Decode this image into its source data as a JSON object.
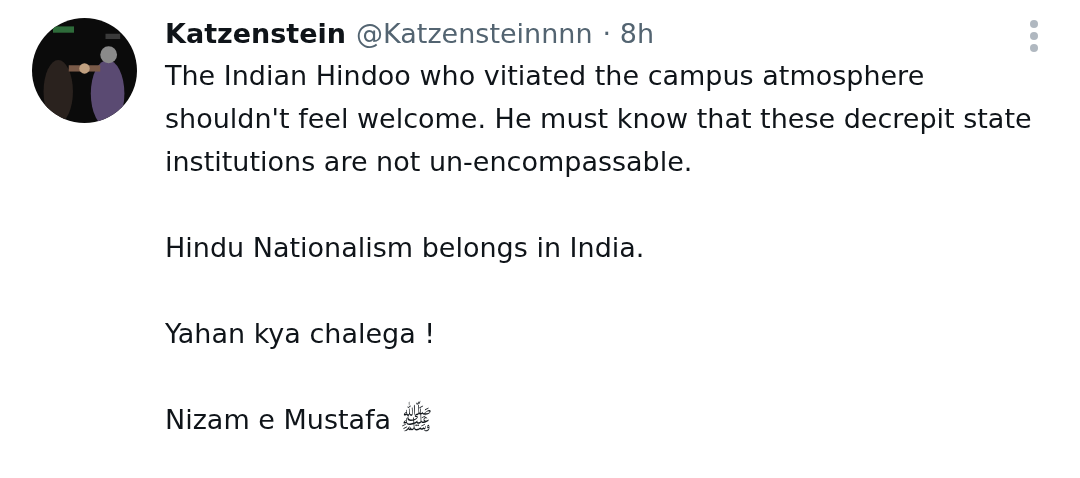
{
  "post": {
    "author": {
      "name": "Katzenstein",
      "handle": "@Katzensteinnnn",
      "time": "· 8h"
    },
    "paragraphs": [
      "The Indian Hindoo who vitiated the campus atmosphere shouldn't feel welcome. He must know that these decrepit state institutions are not un-encompassable.",
      "Hindu Nationalism belongs in India.",
      "Yahan kya chalega !",
      "Nizam e Mustafa ﷺ"
    ]
  }
}
